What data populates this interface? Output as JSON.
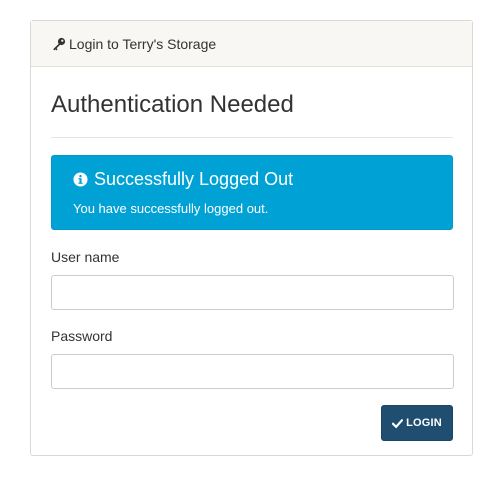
{
  "panel": {
    "heading": "Login to Terry's Storage",
    "heading_icon": "key-icon"
  },
  "main": {
    "title": "Authentication Needed"
  },
  "alert": {
    "icon": "info-icon",
    "title": "Successfully Logged Out",
    "message": "You have successfully logged out.",
    "background_color": "#00a2d5"
  },
  "form": {
    "username_label": "User name",
    "username_value": "",
    "password_label": "Password",
    "password_value": "",
    "login_label": "LOGIN",
    "login_icon": "check-icon",
    "button_color": "#1f4e70"
  }
}
